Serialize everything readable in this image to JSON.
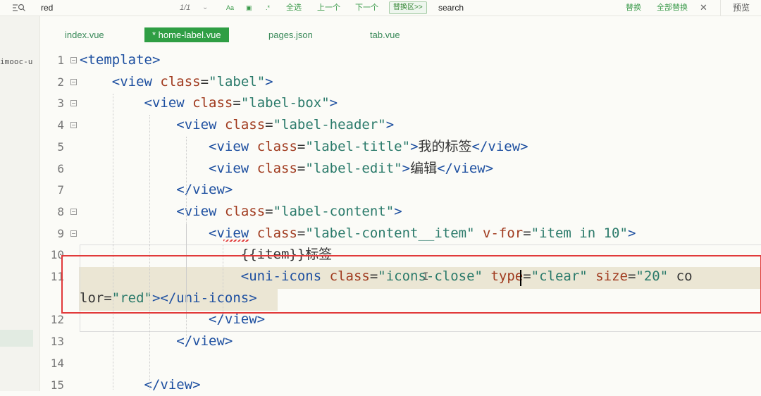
{
  "find_bar": {
    "find_value": "red",
    "match_count": "1/1",
    "option_case": "Aa",
    "option_word": "Â̦",
    "option_regex": ".*",
    "select_all": "全选",
    "prev": "上一个",
    "next": "下一个",
    "replace_area": "替换区>>",
    "replace_value": "search",
    "replace": "替换",
    "replace_all": "全部替换",
    "preview": "预览"
  },
  "sidebar": {
    "project": "imooc-u"
  },
  "tabs": [
    {
      "label": "index.vue",
      "active": false
    },
    {
      "label": "* home-label.vue",
      "active": true
    },
    {
      "label": "pages.json",
      "active": false
    },
    {
      "label": "tab.vue",
      "active": false
    }
  ],
  "colors": {
    "accent": "#2f9e44",
    "tag": "#1d4fa0",
    "attr": "#a03a1e",
    "string": "#2a7a6a",
    "highlight_box": "#e13a3a"
  },
  "lines": [
    {
      "num": "1",
      "text": "<template>"
    },
    {
      "num": "2",
      "text": "    <view class=\"label\">"
    },
    {
      "num": "3",
      "text": "        <view class=\"label-box\">"
    },
    {
      "num": "4",
      "text": "            <view class=\"label-header\">"
    },
    {
      "num": "5",
      "text": "                <view class=\"label-title\">我的标签</view>"
    },
    {
      "num": "6",
      "text": "                <view class=\"label-edit\">编辑</view>"
    },
    {
      "num": "7",
      "text": "            </view>"
    },
    {
      "num": "8",
      "text": "            <view class=\"label-content\">"
    },
    {
      "num": "9",
      "text": "                <view class=\"label-content__item\" v-for=\"item in 10\">"
    },
    {
      "num": "10",
      "text": "                    {{item}}标签"
    },
    {
      "num": "11",
      "text": "                    <uni-icons class=\"icons-close\" type=\"clear\" size=\"20\" co"
    },
    {
      "num": "",
      "text": "lor=\"red\"></uni-icons>"
    },
    {
      "num": "12",
      "text": "                </view>"
    },
    {
      "num": "13",
      "text": "            </view>"
    },
    {
      "num": "14",
      "text": ""
    },
    {
      "num": "15",
      "text": "        </view>"
    }
  ]
}
